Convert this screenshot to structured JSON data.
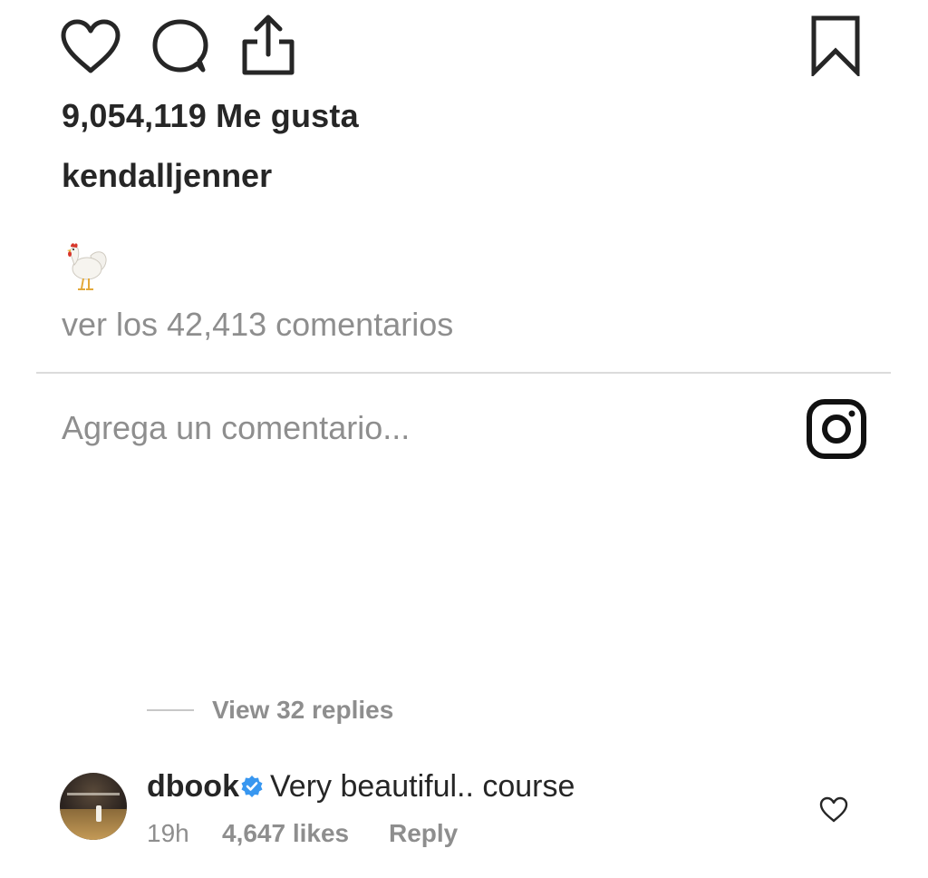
{
  "post": {
    "likes_text": "9,054,119 Me gusta",
    "author": "kendalljenner",
    "caption_emoji": "rooster-emoji",
    "view_comments_text": "ver los 42,413 comentarios"
  },
  "actions": {
    "like_icon": "heart-icon",
    "comment_icon": "comment-bubble-icon",
    "share_icon": "share-icon",
    "save_icon": "bookmark-icon"
  },
  "comment_input": {
    "placeholder": "Agrega un comentario...",
    "value": "",
    "camera_icon": "instagram-icon"
  },
  "replies": {
    "view_replies_text": "View 32 replies"
  },
  "comment": {
    "username": "dbook",
    "verified_icon": "verified-badge-icon",
    "text": "Very beautiful.. course",
    "time": "19h",
    "likes": "4,647 likes",
    "reply_label": "Reply",
    "like_icon": "heart-small-icon"
  },
  "colors": {
    "text_primary": "#262626",
    "text_secondary": "#8e8e8e",
    "divider": "#dbdbdb",
    "verified_blue": "#3897f0"
  }
}
